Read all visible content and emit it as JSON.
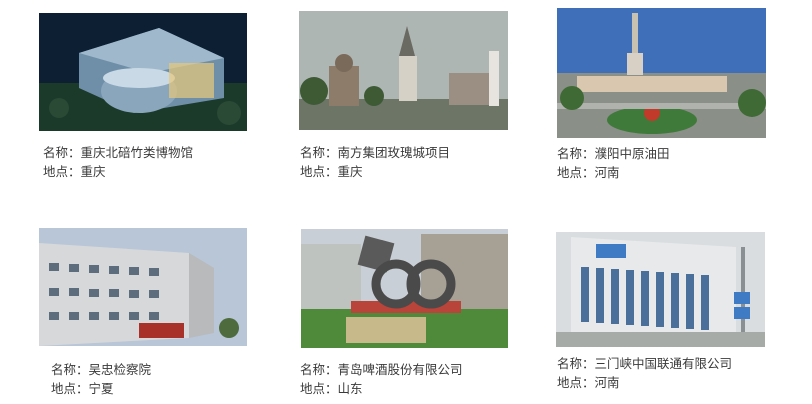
{
  "projects": [
    {
      "name_label": "名称：重庆北碚竹类博物馆",
      "location_label": "地点：重庆",
      "photo": "building-photo"
    },
    {
      "name_label": "名称：南方集团玫瑰城项目",
      "location_label": "地点：重庆",
      "photo": "church-photo"
    },
    {
      "name_label": "名称：濮阳中原油田",
      "location_label": "地点：河南",
      "photo": "city-aerial-photo"
    },
    {
      "name_label": "名称：吴忠检察院",
      "location_label": "地点：宁夏",
      "photo": "office-building-photo"
    },
    {
      "name_label": "名称：青岛啤酒股份有限公司",
      "location_label": "地点：山东",
      "photo": "sculpture-photo"
    },
    {
      "name_label": "名称：三门峡中国联通有限公司",
      "location_label": "地点：河南",
      "photo": "unicom-building-photo"
    }
  ]
}
